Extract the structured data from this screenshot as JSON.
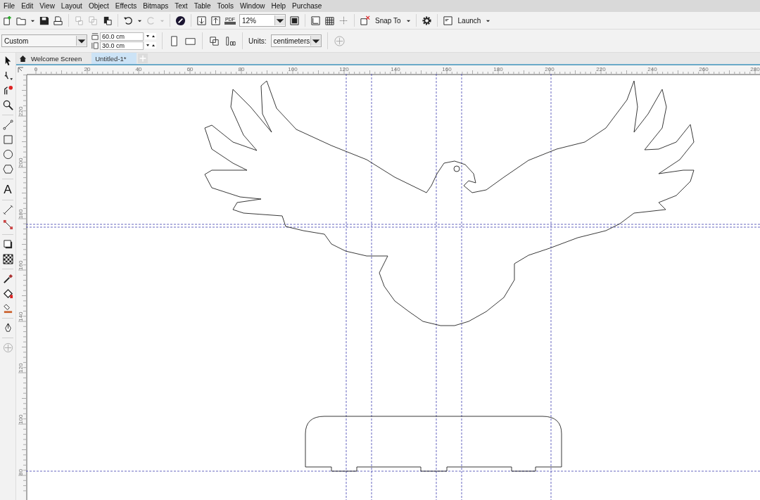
{
  "menu": [
    {
      "label": "File"
    },
    {
      "label": "Edit"
    },
    {
      "label": "View"
    },
    {
      "label": "Layout"
    },
    {
      "label": "Object"
    },
    {
      "label": "Effects"
    },
    {
      "label": "Bitmaps"
    },
    {
      "label": "Text"
    },
    {
      "label": "Table"
    },
    {
      "label": "Tools"
    },
    {
      "label": "Window"
    },
    {
      "label": "Help"
    },
    {
      "label": "Purchase"
    }
  ],
  "toolbar": {
    "pdf_label": "PDF",
    "zoom": "12%",
    "snap": "Snap To",
    "launch": "Launch"
  },
  "property_bar": {
    "page_size": "Custom",
    "width": "60.0 cm",
    "height": "30.0 cm",
    "units_label": "Units:",
    "units": "centimeters"
  },
  "tabs": [
    {
      "label": "Welcome Screen",
      "selected": false,
      "kind": "home"
    },
    {
      "label": "Untitled-1*",
      "selected": true,
      "kind": "document"
    }
  ],
  "toolbox": {
    "text_tool_glyph": "A"
  },
  "ruler": {
    "x_labels": [
      "0",
      "20",
      "40",
      "60",
      "80",
      "100",
      "120",
      "140",
      "160",
      "180",
      "200",
      "220",
      "240",
      "260",
      "280"
    ],
    "y_labels": [
      "220",
      "200",
      "180",
      "160",
      "140",
      "120",
      "100",
      "80"
    ]
  }
}
